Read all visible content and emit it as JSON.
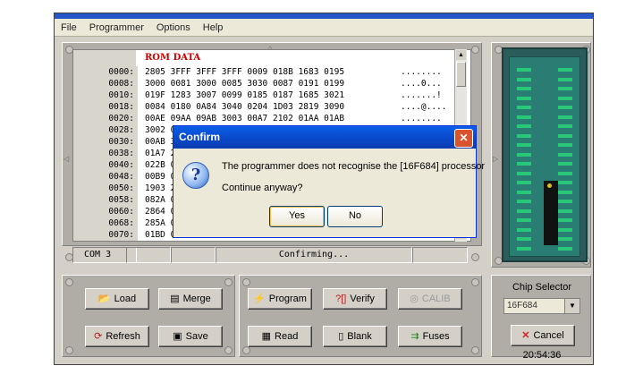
{
  "menu": [
    "File",
    "Programmer",
    "Options",
    "Help"
  ],
  "hex": {
    "title": "ROM DATA",
    "rows": [
      {
        "addr": "0000:",
        "hex": "2805 3FFF 3FFF 3FFF 0009 018B 1683 0195",
        "ascii": "........"
      },
      {
        "addr": "0008:",
        "hex": "3000 0081 3000 0085 3030 0087 0191 0199",
        "ascii": "....0..."
      },
      {
        "addr": "0010:",
        "hex": "019F 1283 3007 0099 0185 0187 1685 3021",
        "ascii": ".......!"
      },
      {
        "addr": "0018:",
        "hex": "0084 0180 0A84 3040 0204 1D03 2819 3090",
        "ascii": "....@...."
      },
      {
        "addr": "0020:",
        "hex": "00AE 09AA 09AB 3003 00A7 2102 01AA 01AB",
        "ascii": "........"
      },
      {
        "addr": "0028:",
        "hex": "3002 00A",
        "ascii": ""
      },
      {
        "addr": "0030:",
        "hex": "00AB 300",
        "ascii": ""
      },
      {
        "addr": "0038:",
        "hex": "01A7 210",
        "ascii": ""
      },
      {
        "addr": "0040:",
        "hex": "022B 082",
        "ascii": ""
      },
      {
        "addr": "0048:",
        "hex": "00B9 01A",
        "ascii": ""
      },
      {
        "addr": "0050:",
        "hex": "1903 286",
        "ascii": ""
      },
      {
        "addr": "0058:",
        "hex": "082A 00A",
        "ascii": ""
      },
      {
        "addr": "0060:",
        "hex": "2864 0FA",
        "ascii": ""
      },
      {
        "addr": "0068:",
        "hex": "285A 01A",
        "ascii": ""
      },
      {
        "addr": "0070:",
        "hex": "01BD 01E",
        "ascii": ""
      }
    ]
  },
  "status": {
    "port": "COM 3",
    "message": "Confirming..."
  },
  "buttons": {
    "load": "Load",
    "merge": "Merge",
    "refresh": "Refresh",
    "save": "Save",
    "program": "Program",
    "verify": "Verify",
    "calib": "CALIB",
    "read": "Read",
    "blank": "Blank",
    "fuses": "Fuses",
    "cancel": "Cancel"
  },
  "chip_selector": {
    "label": "Chip Selector",
    "value": "16F684"
  },
  "clock": "20:54:36",
  "dialog": {
    "title": "Confirm",
    "message": "The programmer does not recognise the [16F684] processor",
    "question": "Continue anyway?",
    "yes": "Yes",
    "no": "No"
  },
  "icons": {
    "dialog": "question-icon",
    "close": "close-icon"
  }
}
